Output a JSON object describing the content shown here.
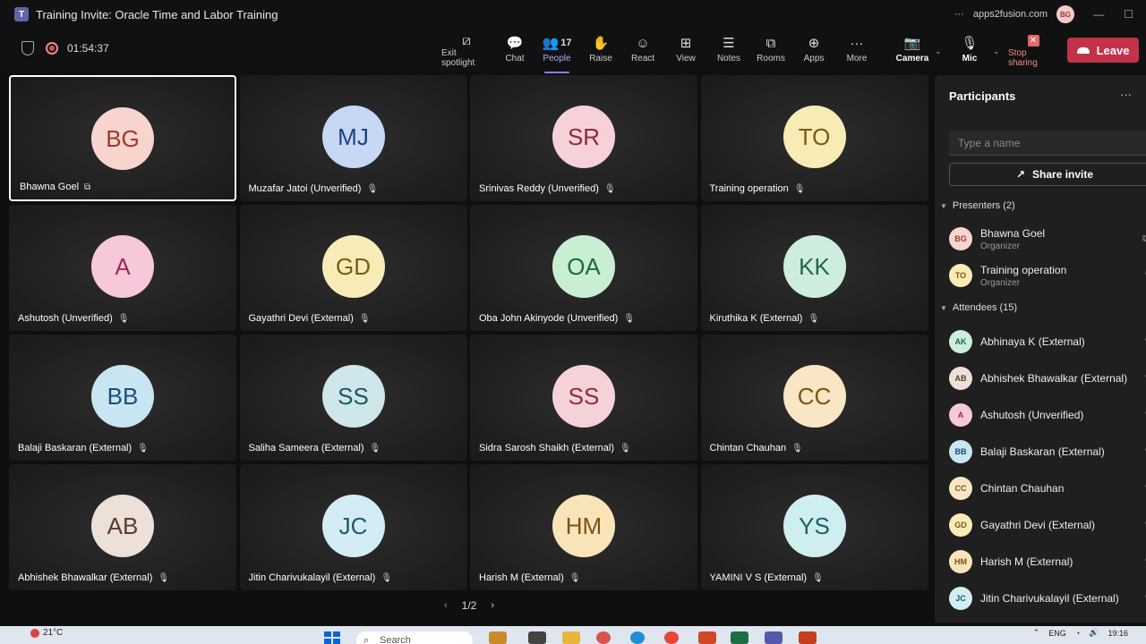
{
  "window": {
    "title": "Training Invite: Oracle Time and Labor Training",
    "account": "apps2fusion.com",
    "account_initials": "BG"
  },
  "meeting": {
    "timer": "01:54:37"
  },
  "toolbar": {
    "exit_spotlight": "Exit spotlight",
    "chat": "Chat",
    "people": "People",
    "people_count": "17",
    "raise": "Raise",
    "react": "React",
    "view": "View",
    "notes": "Notes",
    "rooms": "Rooms",
    "apps": "Apps",
    "more": "More",
    "camera": "Camera",
    "mic": "Mic",
    "stop_sharing": "Stop sharing",
    "leave": "Leave"
  },
  "tiles": [
    {
      "initials": "BG",
      "name": "Bhawna Goel",
      "bg": "#f8d4cf",
      "fg": "#9a3b2e",
      "selected": true,
      "icon": "share"
    },
    {
      "initials": "MJ",
      "name": "Muzafar Jatoi (Unverified)",
      "bg": "#c7d8f5",
      "fg": "#1e3f85"
    },
    {
      "initials": "SR",
      "name": "Srinivas Reddy (Unverified)",
      "bg": "#f6d1d8",
      "fg": "#8c2a3c"
    },
    {
      "initials": "TO",
      "name": "Training operation",
      "bg": "#f8ecb6",
      "fg": "#7a5a10"
    },
    {
      "initials": "A",
      "name": "Ashutosh (Unverified)",
      "bg": "#f6c8da",
      "fg": "#9b2b55"
    },
    {
      "initials": "GD",
      "name": "Gayathri Devi (External)",
      "bg": "#f7ecb8",
      "fg": "#7a5c12"
    },
    {
      "initials": "OA",
      "name": "Oba John Akinyode (Unverified)",
      "bg": "#c9efd3",
      "fg": "#1e6b3a"
    },
    {
      "initials": "KK",
      "name": "Kiruthika K (External)",
      "bg": "#cdeedd",
      "fg": "#1f6a4a"
    },
    {
      "initials": "BB",
      "name": "Balaji Baskaran (External)",
      "bg": "#c8e6f2",
      "fg": "#1c4d7a"
    },
    {
      "initials": "SS",
      "name": "Saliha Sameera (External)",
      "bg": "#cfe6ea",
      "fg": "#1f5560"
    },
    {
      "initials": "SS",
      "name": "Sidra Sarosh Shaikh (External)",
      "bg": "#f4d2d8",
      "fg": "#8e2c3d"
    },
    {
      "initials": "CC",
      "name": "Chintan Chauhan",
      "bg": "#f8e6c4",
      "fg": "#7c5417"
    },
    {
      "initials": "AB",
      "name": "Abhishek Bhawalkar (External)",
      "bg": "#ece0d8",
      "fg": "#5a3c2c"
    },
    {
      "initials": "JC",
      "name": "Jitin Charivukalayil (External)",
      "bg": "#d4ecf4",
      "fg": "#1d5a70"
    },
    {
      "initials": "HM",
      "name": "Harish M (External)",
      "bg": "#f9e4b9",
      "fg": "#7b5312"
    },
    {
      "initials": "YS",
      "name": "YAMINI V S (External)",
      "bg": "#cfeef0",
      "fg": "#1c6268"
    }
  ],
  "pager": {
    "label": "1/2"
  },
  "panel": {
    "title": "Participants",
    "search_placeholder": "Type a name",
    "share_invite": "Share invite",
    "presenters_label": "Presenters (2)",
    "attendees_label": "Attendees (15)",
    "presenters": [
      {
        "initials": "BG",
        "name": "Bhawna Goel",
        "role": "Organizer",
        "bg": "#f8d4cf",
        "fg": "#9a3b2e"
      },
      {
        "initials": "TO",
        "name": "Training operation",
        "role": "Organizer",
        "bg": "#f8ecb6",
        "fg": "#7a5a10"
      }
    ],
    "attendees": [
      {
        "initials": "AK",
        "name": "Abhinaya K (External)",
        "bg": "#cdeedd",
        "fg": "#1f6a4a"
      },
      {
        "initials": "AB",
        "name": "Abhishek Bhawalkar (External)",
        "bg": "#ece0d8",
        "fg": "#5a3c2c"
      },
      {
        "initials": "A",
        "name": "Ashutosh (Unverified)",
        "bg": "#f6c8da",
        "fg": "#9b2b55"
      },
      {
        "initials": "BB",
        "name": "Balaji Baskaran (External)",
        "bg": "#c8e6f2",
        "fg": "#1c4d7a"
      },
      {
        "initials": "CC",
        "name": "Chintan Chauhan",
        "bg": "#f8e6c4",
        "fg": "#7c5417"
      },
      {
        "initials": "GD",
        "name": "Gayathri Devi (External)",
        "bg": "#f7ecb8",
        "fg": "#7a5c12"
      },
      {
        "initials": "HM",
        "name": "Harish M (External)",
        "bg": "#f9e4b9",
        "fg": "#7b5312"
      },
      {
        "initials": "JC",
        "name": "Jitin Charivukalayil (External)",
        "bg": "#d4ecf4",
        "fg": "#1d5a70"
      }
    ]
  },
  "taskbar": {
    "weather": "21°C",
    "search": "Search",
    "lang": "ENG",
    "time": "19:16"
  }
}
